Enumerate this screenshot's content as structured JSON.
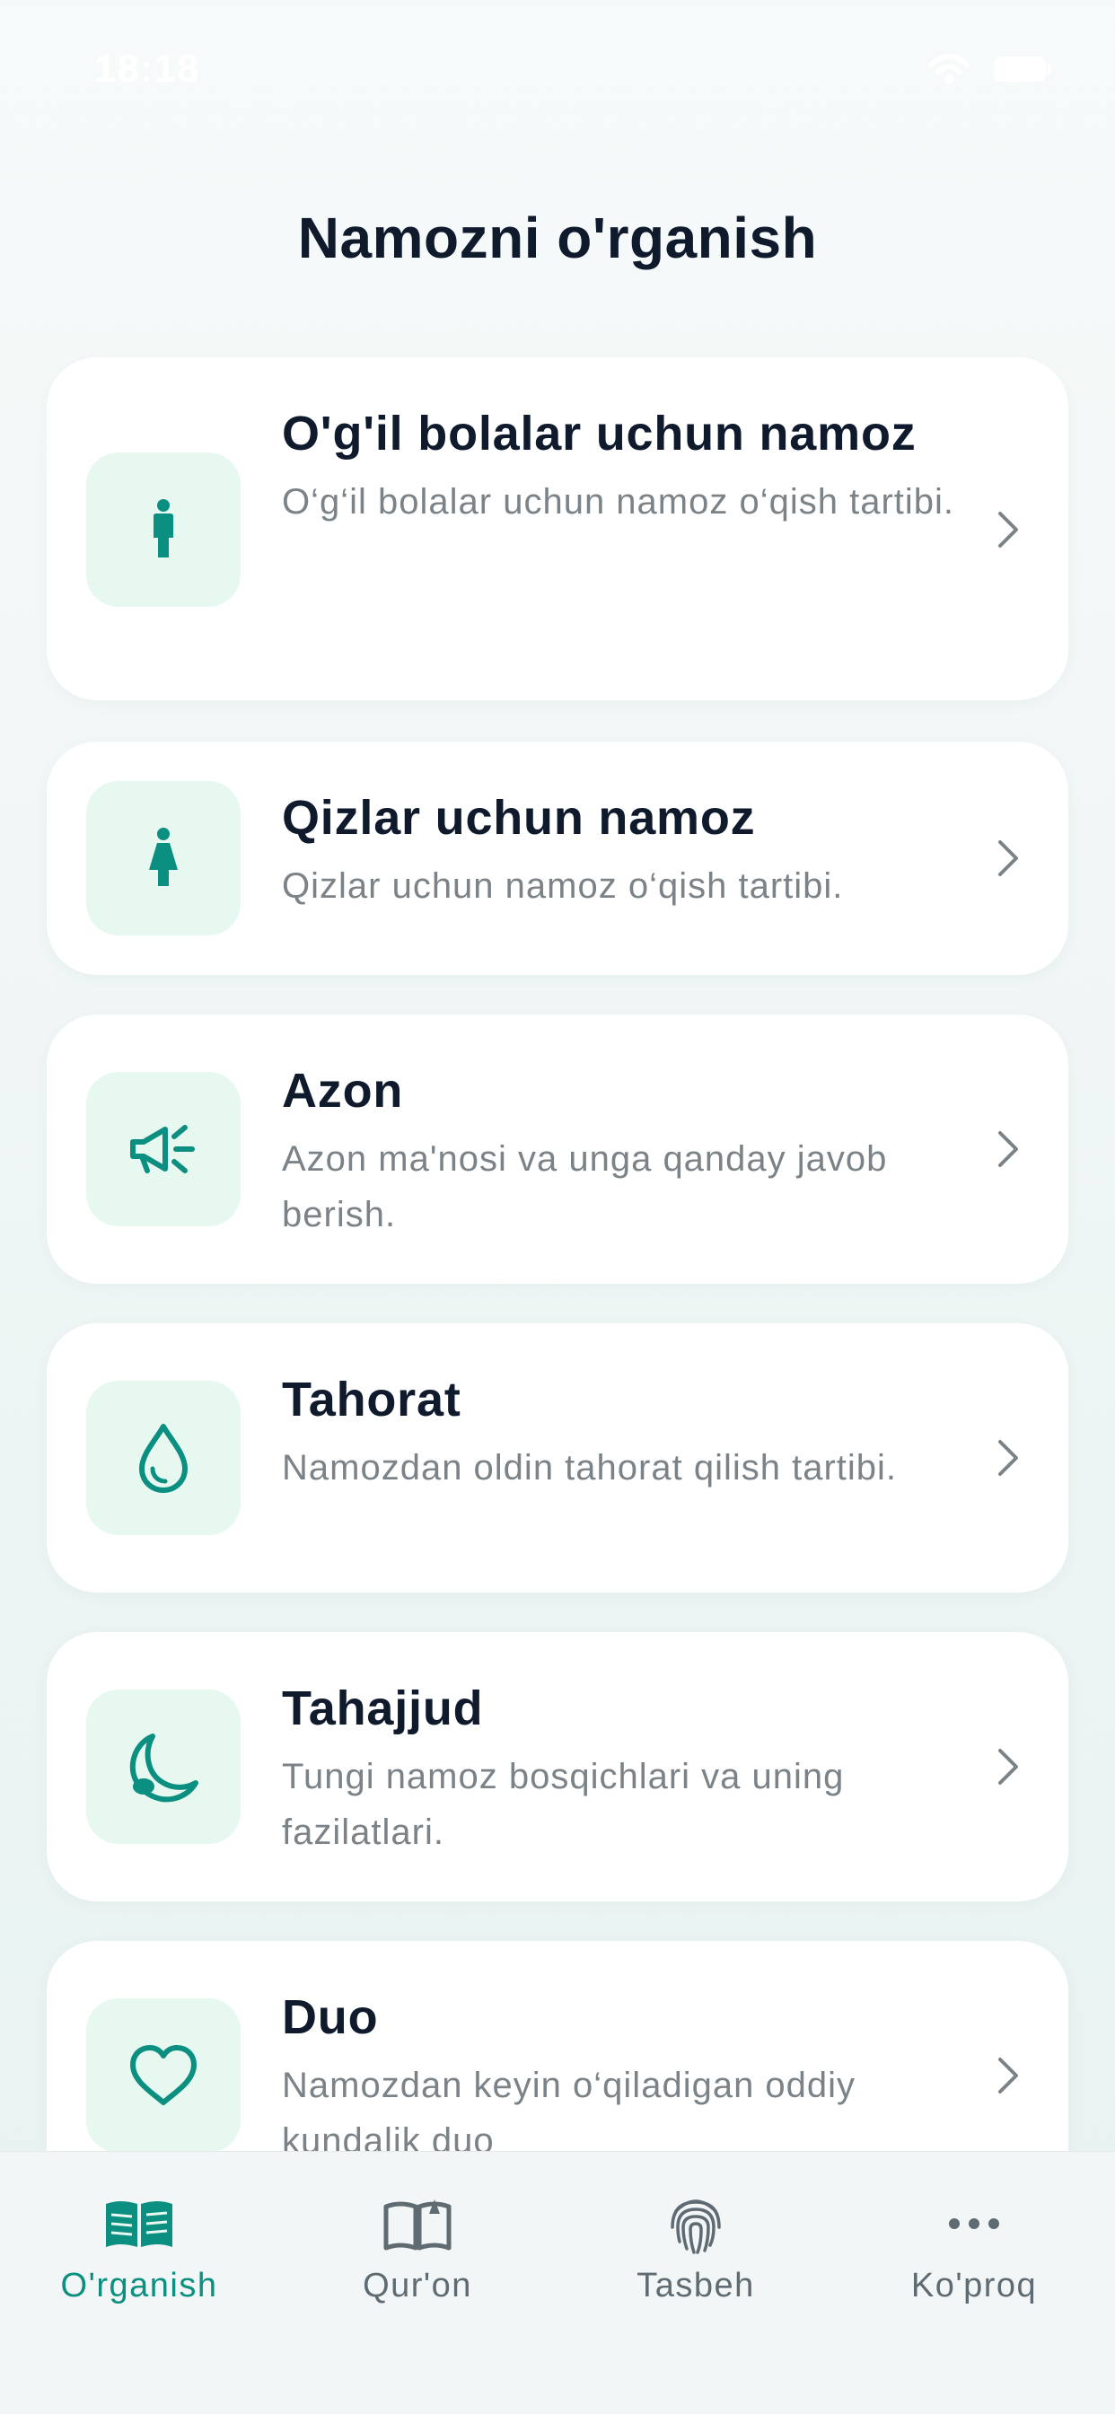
{
  "status": {
    "time": "18:18"
  },
  "page": {
    "title": "Namozni o'rganish"
  },
  "items": [
    {
      "title": "O'g'il bolalar uchun namoz",
      "desc": "O‘g‘il bolalar uchun namoz o‘qish tartibi.",
      "icon": "boy-icon"
    },
    {
      "title": "Qizlar uchun namoz",
      "desc": "Qizlar uchun namoz o‘qish tartibi.",
      "icon": "girl-icon"
    },
    {
      "title": "Azon",
      "desc": "Azon ma'nosi va unga qanday javob berish.",
      "icon": "megaphone-icon"
    },
    {
      "title": "Tahorat",
      "desc": "Namozdan oldin tahorat qilish tartibi.",
      "icon": "water-drop-icon"
    },
    {
      "title": "Tahajjud",
      "desc": "Tungi namoz bosqichlari va uning fazilatlari.",
      "icon": "moon-icon"
    },
    {
      "title": "Duo",
      "desc": "Namozdan keyin o‘qiladigan oddiy kundalik duo",
      "icon": "heart-icon"
    }
  ],
  "tabs": [
    {
      "label": "O'rganish",
      "icon": "open-book-icon",
      "active": true
    },
    {
      "label": "Qur'on",
      "icon": "quran-book-icon",
      "active": false
    },
    {
      "label": "Tasbeh",
      "icon": "fingerprint-icon",
      "active": false
    },
    {
      "label": "Ko'proq",
      "icon": "more-icon",
      "active": false
    }
  ],
  "colors": {
    "accent": "#0b8f80",
    "icon_bg": "#e6f8f0",
    "title": "#0f1b2d",
    "muted": "#7b8388"
  }
}
